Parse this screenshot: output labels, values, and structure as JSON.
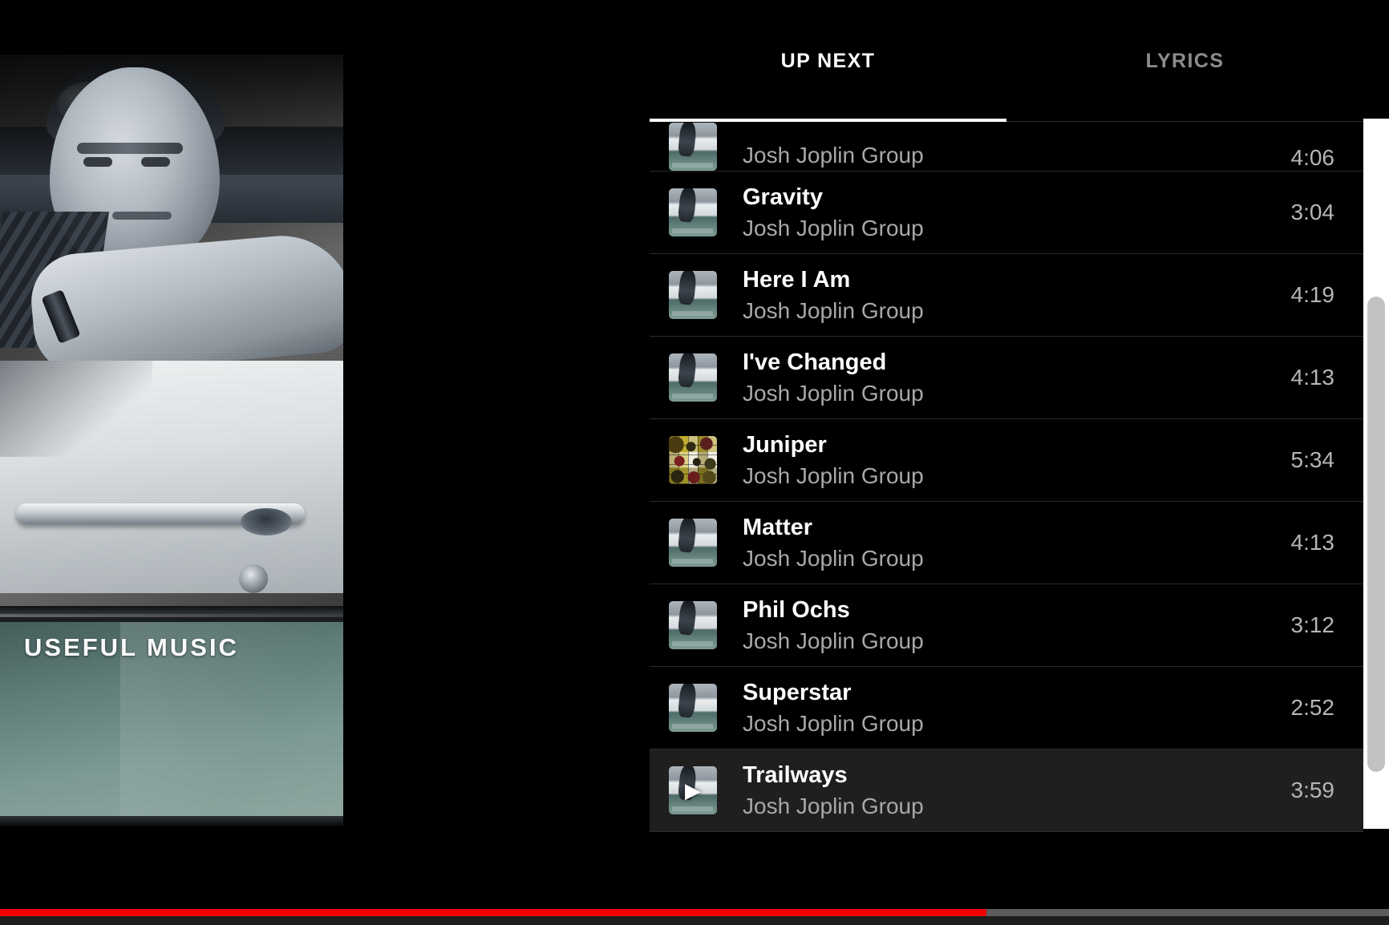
{
  "album_art": {
    "title_text": "USEFUL MUSIC",
    "alt": "Black and white photo of a man leaning on the door of a teal car"
  },
  "tabs": [
    {
      "label": "UP NEXT",
      "active": true
    },
    {
      "label": "LYRICS",
      "active": false
    }
  ],
  "queue": {
    "tracks": [
      {
        "title": "",
        "artist": "Josh Joplin Group",
        "duration": "4:06",
        "thumb": "album",
        "partial": true,
        "current": false
      },
      {
        "title": "Gravity",
        "artist": "Josh Joplin Group",
        "duration": "3:04",
        "thumb": "album",
        "partial": false,
        "current": false
      },
      {
        "title": "Here I Am",
        "artist": "Josh Joplin Group",
        "duration": "4:19",
        "thumb": "album",
        "partial": false,
        "current": false
      },
      {
        "title": "I've Changed",
        "artist": "Josh Joplin Group",
        "duration": "4:13",
        "thumb": "album",
        "partial": false,
        "current": false
      },
      {
        "title": "Juniper",
        "artist": "Josh Joplin Group",
        "duration": "5:34",
        "thumb": "grid",
        "partial": false,
        "current": false
      },
      {
        "title": "Matter",
        "artist": "Josh Joplin Group",
        "duration": "4:13",
        "thumb": "album",
        "partial": false,
        "current": false
      },
      {
        "title": "Phil Ochs",
        "artist": "Josh Joplin Group",
        "duration": "3:12",
        "thumb": "album",
        "partial": false,
        "current": false
      },
      {
        "title": "Superstar",
        "artist": "Josh Joplin Group",
        "duration": "2:52",
        "thumb": "album",
        "partial": false,
        "current": false
      },
      {
        "title": "Trailways",
        "artist": "Josh Joplin Group",
        "duration": "3:59",
        "thumb": "album",
        "partial": false,
        "current": true
      }
    ]
  },
  "scrollbar": {
    "thumb_top_pct": 25,
    "thumb_height_pct": 67
  },
  "player": {
    "progress_percent": 71,
    "progress_color": "#f00000",
    "track_color": "#5c5c5c"
  },
  "colors": {
    "background": "#000000",
    "accent": "#ffffff",
    "secondary_text": "#a8a8a8",
    "row_highlight": "#1f1f1f",
    "divider": "#2b2b2b"
  },
  "icons": {
    "play_glyph": "▶"
  }
}
